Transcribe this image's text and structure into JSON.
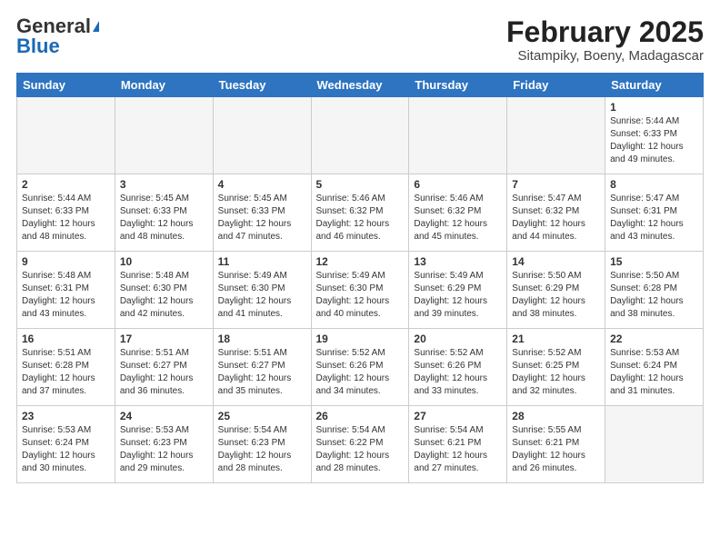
{
  "header": {
    "logo_general": "General",
    "logo_blue": "Blue",
    "title": "February 2025",
    "subtitle": "Sitampiky, Boeny, Madagascar"
  },
  "weekdays": [
    "Sunday",
    "Monday",
    "Tuesday",
    "Wednesday",
    "Thursday",
    "Friday",
    "Saturday"
  ],
  "weeks": [
    [
      {
        "day": "",
        "info": ""
      },
      {
        "day": "",
        "info": ""
      },
      {
        "day": "",
        "info": ""
      },
      {
        "day": "",
        "info": ""
      },
      {
        "day": "",
        "info": ""
      },
      {
        "day": "",
        "info": ""
      },
      {
        "day": "1",
        "info": "Sunrise: 5:44 AM\nSunset: 6:33 PM\nDaylight: 12 hours\nand 49 minutes."
      }
    ],
    [
      {
        "day": "2",
        "info": "Sunrise: 5:44 AM\nSunset: 6:33 PM\nDaylight: 12 hours\nand 48 minutes."
      },
      {
        "day": "3",
        "info": "Sunrise: 5:45 AM\nSunset: 6:33 PM\nDaylight: 12 hours\nand 48 minutes."
      },
      {
        "day": "4",
        "info": "Sunrise: 5:45 AM\nSunset: 6:33 PM\nDaylight: 12 hours\nand 47 minutes."
      },
      {
        "day": "5",
        "info": "Sunrise: 5:46 AM\nSunset: 6:32 PM\nDaylight: 12 hours\nand 46 minutes."
      },
      {
        "day": "6",
        "info": "Sunrise: 5:46 AM\nSunset: 6:32 PM\nDaylight: 12 hours\nand 45 minutes."
      },
      {
        "day": "7",
        "info": "Sunrise: 5:47 AM\nSunset: 6:32 PM\nDaylight: 12 hours\nand 44 minutes."
      },
      {
        "day": "8",
        "info": "Sunrise: 5:47 AM\nSunset: 6:31 PM\nDaylight: 12 hours\nand 43 minutes."
      }
    ],
    [
      {
        "day": "9",
        "info": "Sunrise: 5:48 AM\nSunset: 6:31 PM\nDaylight: 12 hours\nand 43 minutes."
      },
      {
        "day": "10",
        "info": "Sunrise: 5:48 AM\nSunset: 6:30 PM\nDaylight: 12 hours\nand 42 minutes."
      },
      {
        "day": "11",
        "info": "Sunrise: 5:49 AM\nSunset: 6:30 PM\nDaylight: 12 hours\nand 41 minutes."
      },
      {
        "day": "12",
        "info": "Sunrise: 5:49 AM\nSunset: 6:30 PM\nDaylight: 12 hours\nand 40 minutes."
      },
      {
        "day": "13",
        "info": "Sunrise: 5:49 AM\nSunset: 6:29 PM\nDaylight: 12 hours\nand 39 minutes."
      },
      {
        "day": "14",
        "info": "Sunrise: 5:50 AM\nSunset: 6:29 PM\nDaylight: 12 hours\nand 38 minutes."
      },
      {
        "day": "15",
        "info": "Sunrise: 5:50 AM\nSunset: 6:28 PM\nDaylight: 12 hours\nand 38 minutes."
      }
    ],
    [
      {
        "day": "16",
        "info": "Sunrise: 5:51 AM\nSunset: 6:28 PM\nDaylight: 12 hours\nand 37 minutes."
      },
      {
        "day": "17",
        "info": "Sunrise: 5:51 AM\nSunset: 6:27 PM\nDaylight: 12 hours\nand 36 minutes."
      },
      {
        "day": "18",
        "info": "Sunrise: 5:51 AM\nSunset: 6:27 PM\nDaylight: 12 hours\nand 35 minutes."
      },
      {
        "day": "19",
        "info": "Sunrise: 5:52 AM\nSunset: 6:26 PM\nDaylight: 12 hours\nand 34 minutes."
      },
      {
        "day": "20",
        "info": "Sunrise: 5:52 AM\nSunset: 6:26 PM\nDaylight: 12 hours\nand 33 minutes."
      },
      {
        "day": "21",
        "info": "Sunrise: 5:52 AM\nSunset: 6:25 PM\nDaylight: 12 hours\nand 32 minutes."
      },
      {
        "day": "22",
        "info": "Sunrise: 5:53 AM\nSunset: 6:24 PM\nDaylight: 12 hours\nand 31 minutes."
      }
    ],
    [
      {
        "day": "23",
        "info": "Sunrise: 5:53 AM\nSunset: 6:24 PM\nDaylight: 12 hours\nand 30 minutes."
      },
      {
        "day": "24",
        "info": "Sunrise: 5:53 AM\nSunset: 6:23 PM\nDaylight: 12 hours\nand 29 minutes."
      },
      {
        "day": "25",
        "info": "Sunrise: 5:54 AM\nSunset: 6:23 PM\nDaylight: 12 hours\nand 28 minutes."
      },
      {
        "day": "26",
        "info": "Sunrise: 5:54 AM\nSunset: 6:22 PM\nDaylight: 12 hours\nand 28 minutes."
      },
      {
        "day": "27",
        "info": "Sunrise: 5:54 AM\nSunset: 6:21 PM\nDaylight: 12 hours\nand 27 minutes."
      },
      {
        "day": "28",
        "info": "Sunrise: 5:55 AM\nSunset: 6:21 PM\nDaylight: 12 hours\nand 26 minutes."
      },
      {
        "day": "",
        "info": ""
      }
    ]
  ]
}
